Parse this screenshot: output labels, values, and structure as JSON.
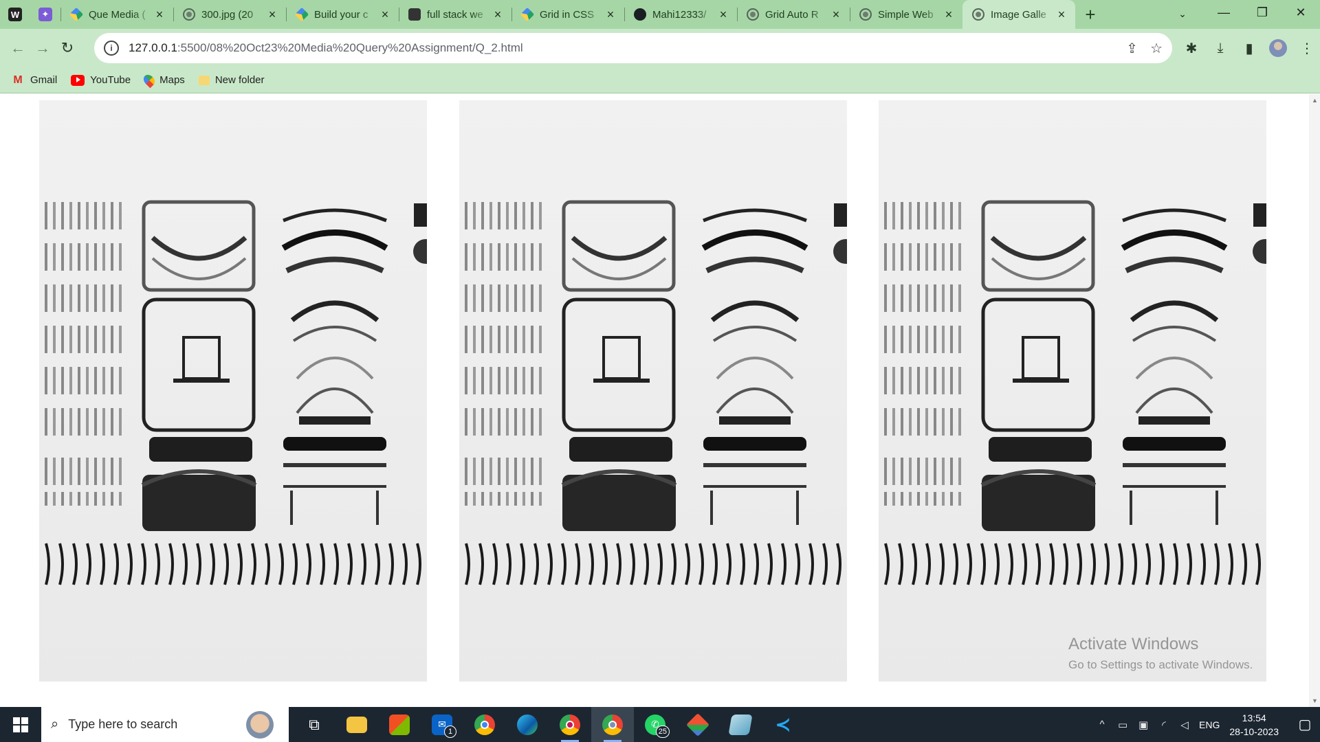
{
  "browser": {
    "pinned_tabs": [
      {
        "icon": "wordpress-icon",
        "glyph": "W"
      },
      {
        "icon": "sparkle-icon",
        "glyph": "✦"
      }
    ],
    "tabs": [
      {
        "title": "Que Media (",
        "icon": "google-drive-icon"
      },
      {
        "title": "300.jpg (20",
        "icon": "globe-icon"
      },
      {
        "title": "Build your c",
        "icon": "google-drive-icon"
      },
      {
        "title": "full stack we",
        "icon": "wordpress-icon"
      },
      {
        "title": "Grid in CSS",
        "icon": "google-drive-icon"
      },
      {
        "title": "Mahi12333/",
        "icon": "github-icon"
      },
      {
        "title": "Grid Auto R",
        "icon": "globe-icon"
      },
      {
        "title": "Simple Web",
        "icon": "globe-icon"
      },
      {
        "title": "Image Galle",
        "icon": "globe-icon",
        "active": true
      }
    ],
    "new_tab_label": "+",
    "address": {
      "host": "127.0.0.1",
      "path": ":5500/08%20Oct23%20Media%20Query%20Assignment/Q_2.html"
    },
    "bookmarks": [
      {
        "label": "Gmail",
        "icon": "gmail-icon"
      },
      {
        "label": "YouTube",
        "icon": "youtube-icon"
      },
      {
        "label": "Maps",
        "icon": "maps-icon"
      },
      {
        "label": "New folder",
        "icon": "folder-icon"
      }
    ]
  },
  "page": {
    "gallery": [
      {
        "alt": "Disassembled typewriter parts flat lay",
        "icon": "typewriter-parts-image"
      },
      {
        "alt": "Disassembled typewriter parts flat lay",
        "icon": "typewriter-parts-image"
      },
      {
        "alt": "Disassembled typewriter parts flat lay",
        "icon": "typewriter-parts-image"
      }
    ]
  },
  "watermark": {
    "line1": "Activate Windows",
    "line2": "Go to Settings to activate Windows."
  },
  "taskbar": {
    "search_placeholder": "Type here to search",
    "apps": [
      {
        "name": "task-view",
        "icon": "task-view-icon"
      },
      {
        "name": "file-explorer",
        "icon": "folder-icon"
      },
      {
        "name": "microsoft-store",
        "icon": "store-icon"
      },
      {
        "name": "mail",
        "icon": "mail-icon",
        "badge": "1"
      },
      {
        "name": "chrome",
        "icon": "chrome-icon"
      },
      {
        "name": "edge",
        "icon": "edge-icon"
      },
      {
        "name": "chrome-profile-m",
        "icon": "chrome-icon"
      },
      {
        "name": "chrome-profile-2",
        "icon": "chrome-icon"
      },
      {
        "name": "whatsapp",
        "icon": "whatsapp-icon",
        "badge": "25"
      },
      {
        "name": "git",
        "icon": "git-icon"
      },
      {
        "name": "notepad",
        "icon": "notepad-icon"
      },
      {
        "name": "vscode",
        "icon": "vscode-icon"
      }
    ],
    "language": "ENG",
    "time": "13:54",
    "date": "28-10-2023"
  },
  "colors": {
    "frame": "#a6d6a6",
    "toolbar": "#c9e8c9",
    "taskbar": "#1c2631"
  }
}
